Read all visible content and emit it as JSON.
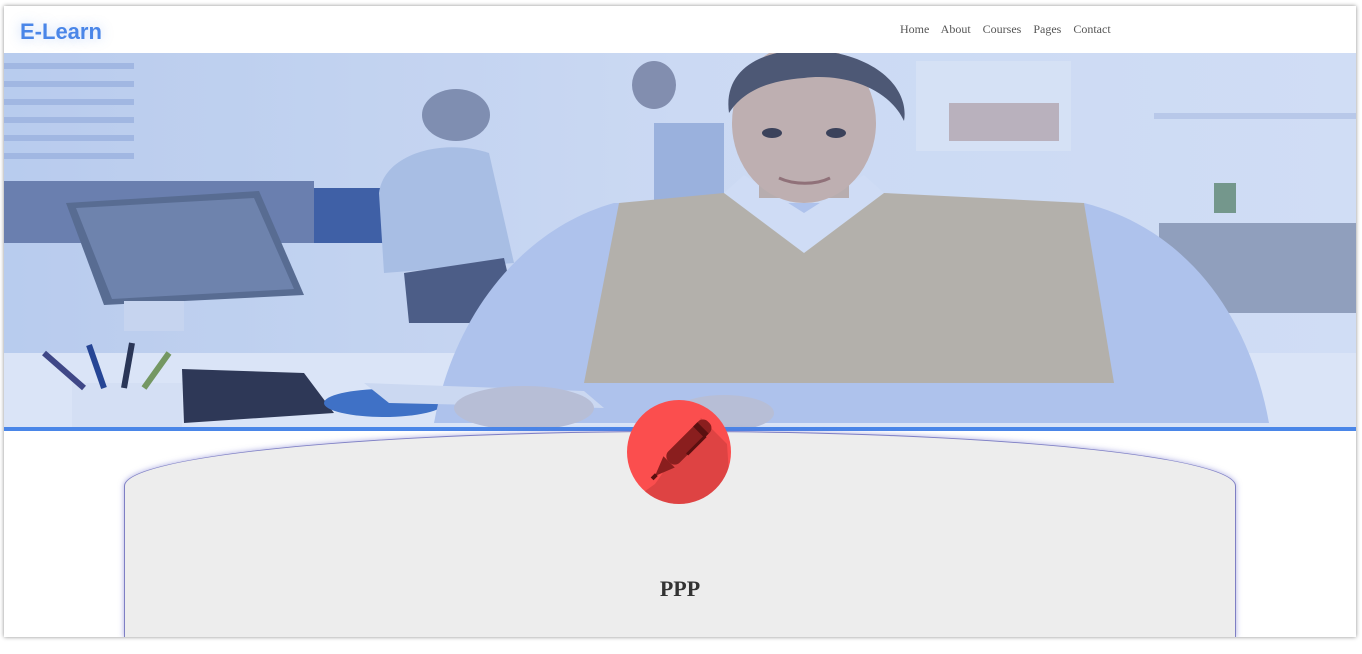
{
  "brand": {
    "name": "E-Learn"
  },
  "nav": {
    "items": [
      {
        "label": "Home"
      },
      {
        "label": "About"
      },
      {
        "label": "Courses"
      },
      {
        "label": "Pages"
      },
      {
        "label": "Contact"
      }
    ]
  },
  "hero": {
    "image": "person-at-office-desk-with-blue-overlay",
    "overlay_color": "#4a86e8"
  },
  "feature": {
    "icon": "pen-icon",
    "icon_color": "#fb4e4e",
    "title": "PPP"
  },
  "colors": {
    "accent": "#4a86e8",
    "card_bg": "#ededed"
  }
}
